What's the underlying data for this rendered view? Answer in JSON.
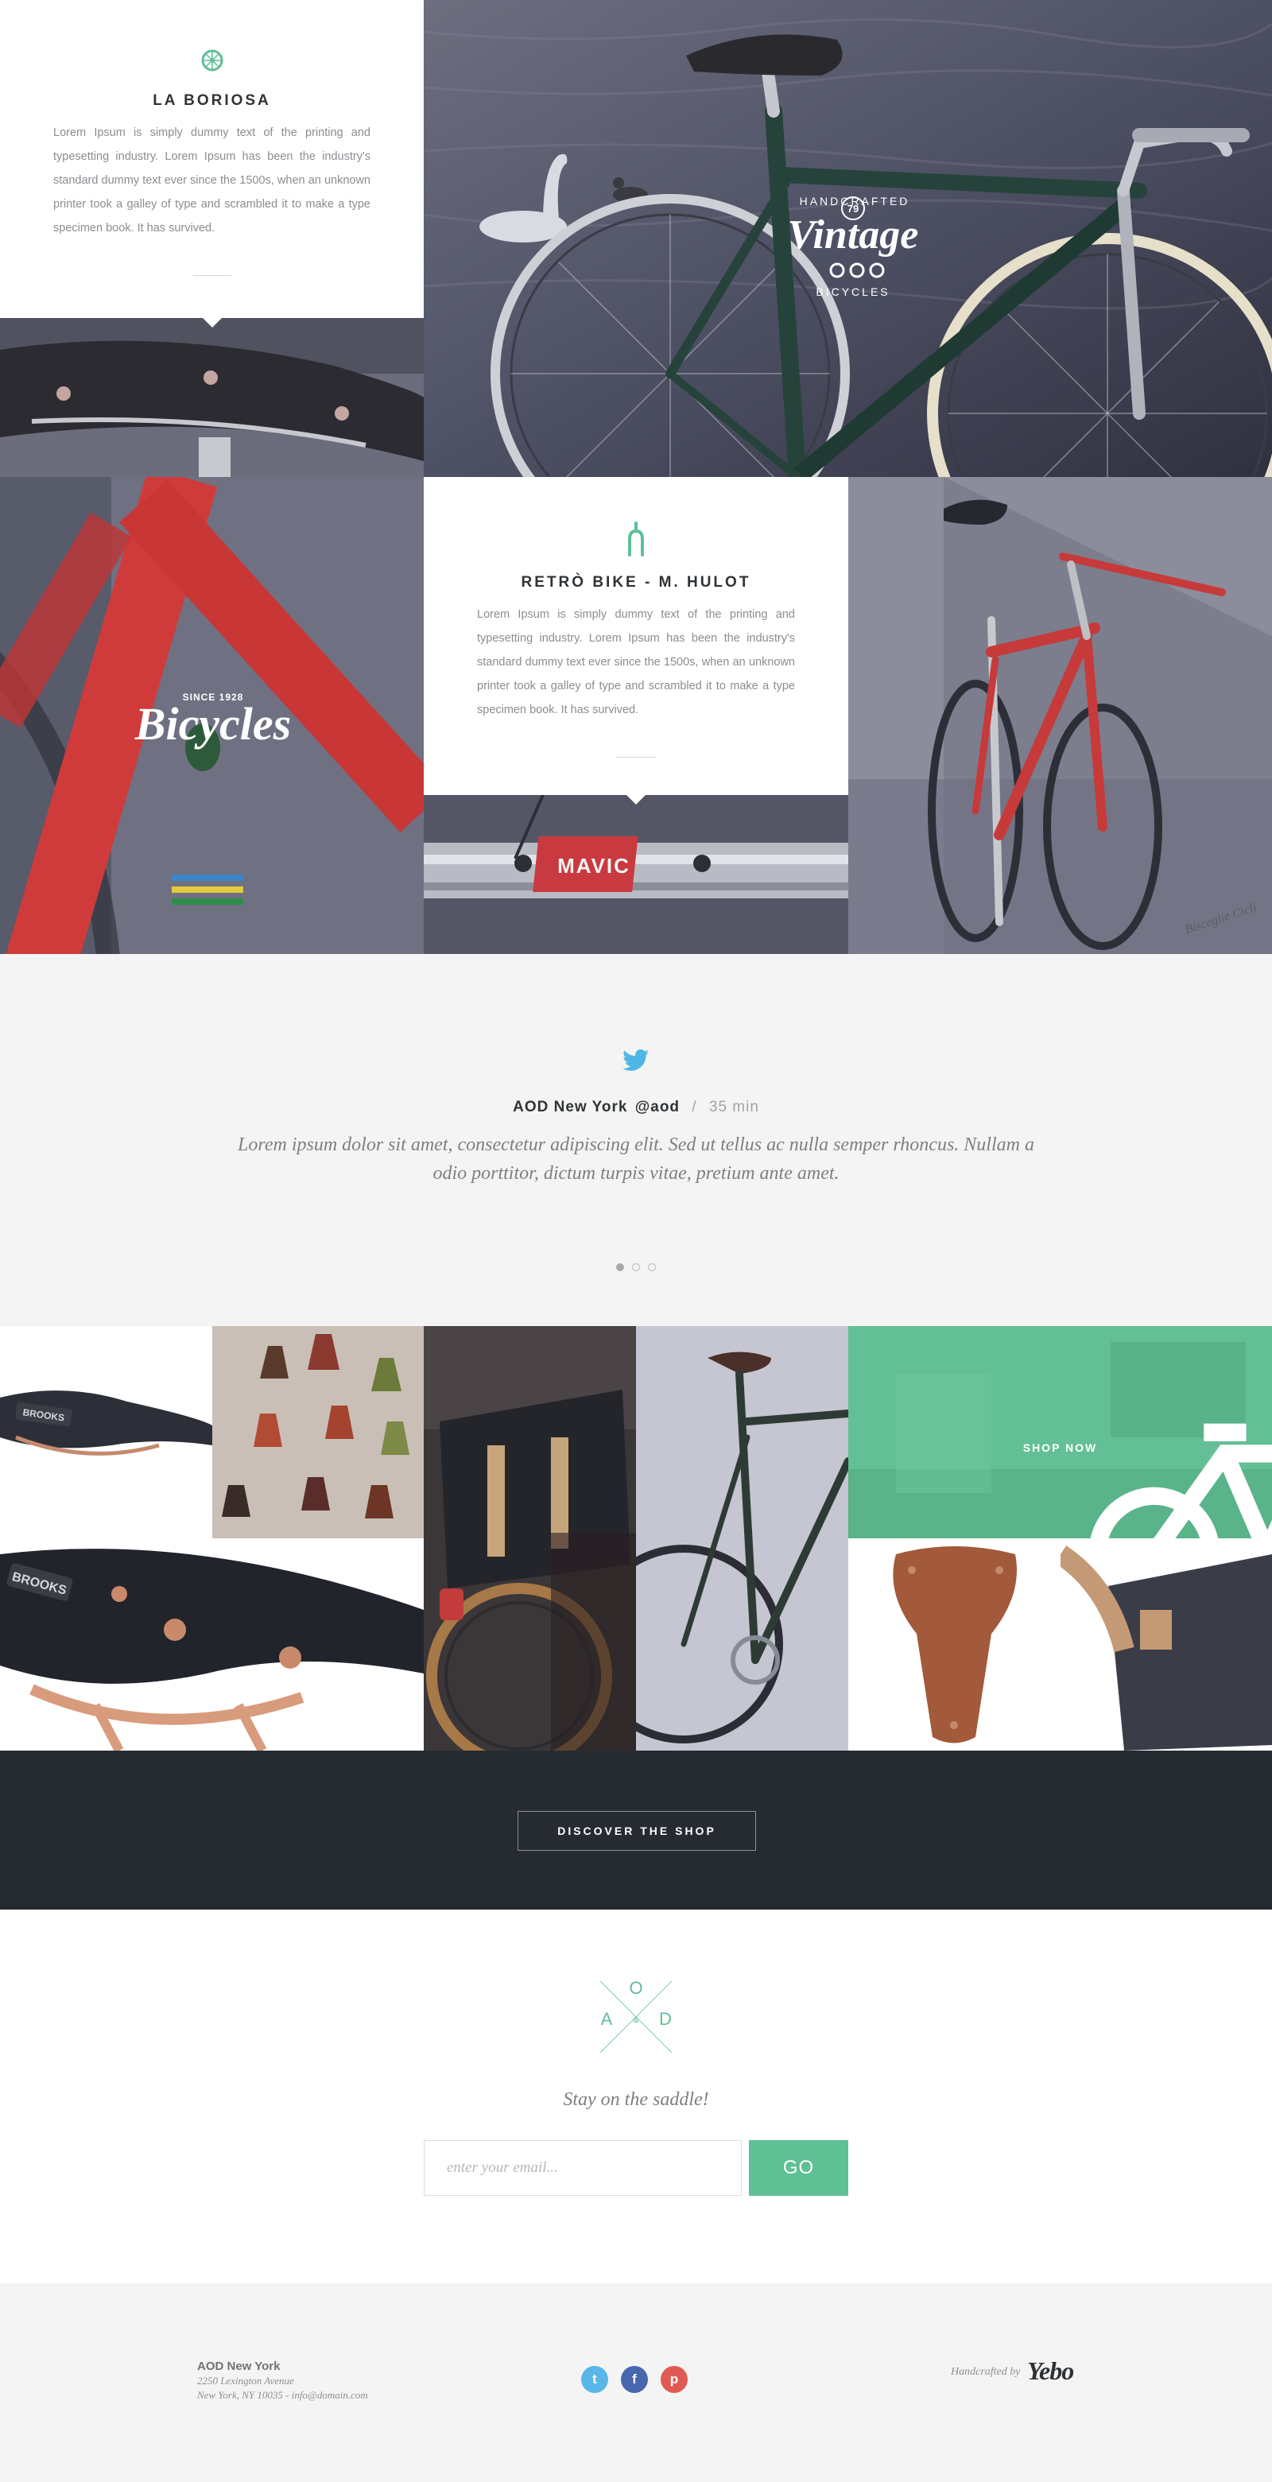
{
  "cards": {
    "boriosa": {
      "title": "LA BORIOSA",
      "icon": "bicycle-wheel-icon",
      "text": "Lorem Ipsum is simply dummy text of the printing and typesetting industry. Lorem Ipsum has been the industry's standard dummy text ever since the 1500s, when an unknown printer took a galley of type and scrambled it to make a type specimen book. It has survived."
    },
    "hulot": {
      "title": "RETRÒ BIKE - M. HULOT",
      "icon": "bicycle-fork-icon",
      "text": "Lorem Ipsum is simply dummy text of the printing and typesetting industry. Lorem Ipsum has been the industry's standard dummy text ever since the 1500s, when an unknown printer took a galley of type and scrambled it to make a type specimen book. It has survived."
    }
  },
  "photos": {
    "hero_badge_top": "HANDCRAFTED",
    "hero_badge_num": "79",
    "hero_badge_word": "Vintage",
    "hero_badge_bottom": "BICYCLES",
    "frame_badge_since": "SINCE 1928",
    "frame_badge_word": "Bicycles",
    "rim_label": "MAVIC",
    "wall_watermark": "Bisceglie Cicli"
  },
  "tweet": {
    "icon": "twitter-bird-icon",
    "author": "AOD New York",
    "handle": "@aod",
    "separator": "/",
    "time": "35 min",
    "text": "Lorem ipsum dolor sit amet, consectetur adipiscing elit. Sed ut tellus ac nulla semper rhoncus. Nullam a odio porttitor, dictum turpis vitae, pretium ante amet.",
    "pager_active": 1,
    "pager_count": 3
  },
  "gallery": {
    "saddle_brand_small": "BROOKS",
    "saddle_brand_large": "BROOKS",
    "shop_now_label": "SHOP NOW",
    "shop_now_icon": "bicycle-icon"
  },
  "shop": {
    "cta_label": "DISCOVER THE SHOP"
  },
  "newsletter": {
    "logo_letters": [
      "O",
      "A",
      "&",
      "D"
    ],
    "tagline": "Stay on the saddle!",
    "email_placeholder": "enter your email...",
    "submit_label": "GO"
  },
  "footer": {
    "name": "AOD New York",
    "street": "2250 Lexington Avenue",
    "city_email": "New York, NY 10035 - info@domain.com",
    "social": [
      {
        "name": "twitter",
        "glyph": "t",
        "color": "#58b7e8"
      },
      {
        "name": "facebook",
        "glyph": "f",
        "color": "#4767ae"
      },
      {
        "name": "pinterest",
        "glyph": "p",
        "color": "#e15a51"
      }
    ],
    "credit": "Handcrafted by",
    "credit_logo": "Yebo"
  },
  "colors": {
    "accent": "#5fbf95",
    "dark": "#262b31",
    "twitter": "#4fb7e6"
  }
}
